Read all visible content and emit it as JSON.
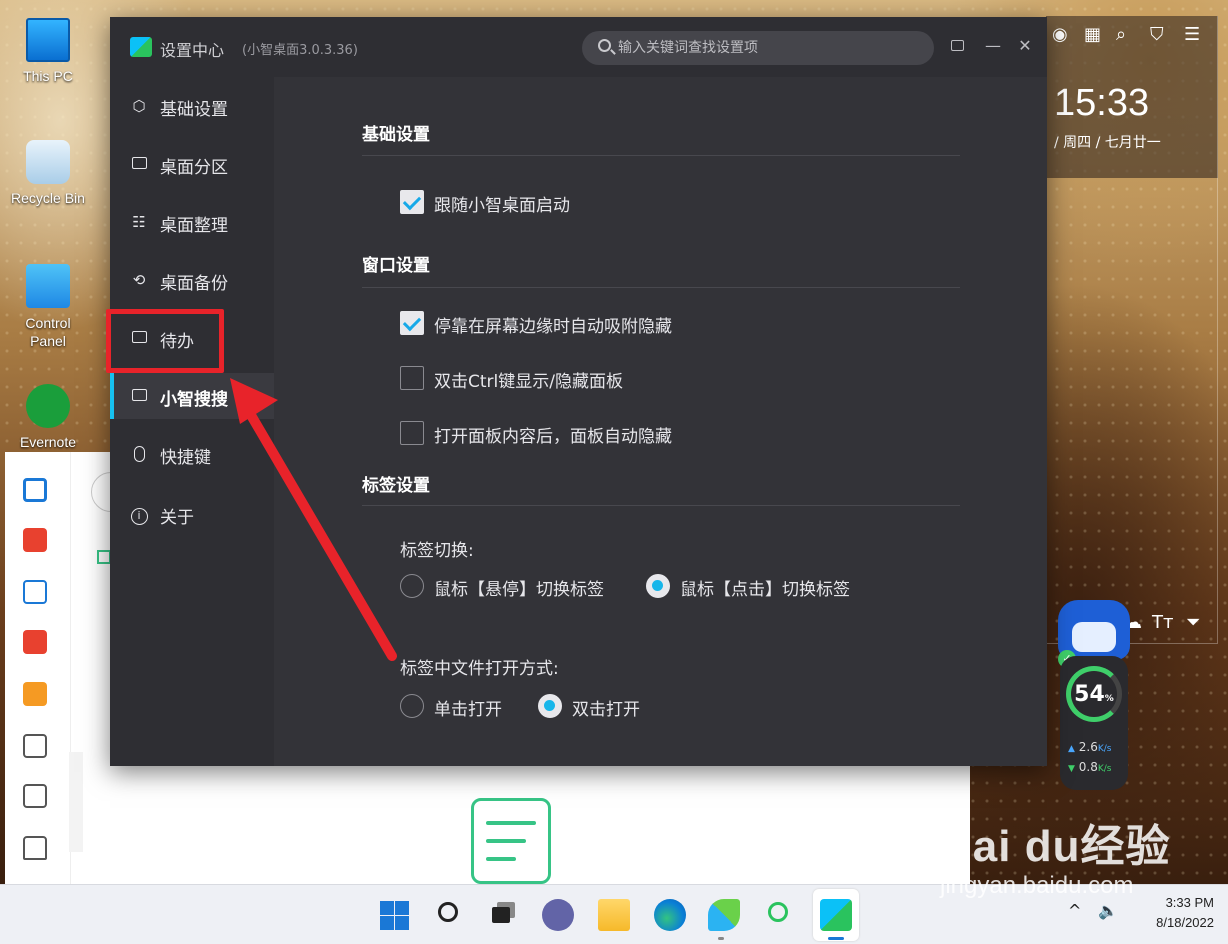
{
  "desktop": {
    "icons": [
      {
        "label": "This PC"
      },
      {
        "label": "Recycle Bin"
      },
      {
        "label": "Control\nPanel"
      },
      {
        "label": "Evernote"
      }
    ]
  },
  "clock_widget": {
    "time": "15:33",
    "date": "/ 周四 / 七月廿一",
    "icons": [
      "user-icon",
      "calendar-icon",
      "search-icon",
      "shirt-icon",
      "menu-icon"
    ]
  },
  "speed_widget": {
    "percent": "54",
    "percent_unit": "%",
    "upload": "2.6",
    "download": "0.8",
    "unit": "K/s"
  },
  "settings_window": {
    "title": "设置中心",
    "version": "(小智桌面3.0.3.36)",
    "search_placeholder": "输入关键词查找设置项",
    "sidebar": {
      "items": [
        {
          "label": "基础设置",
          "icon": "hexagon-icon"
        },
        {
          "label": "桌面分区",
          "icon": "monitor-icon"
        },
        {
          "label": "桌面整理",
          "icon": "grid-list-icon"
        },
        {
          "label": "桌面备份",
          "icon": "sync-icon"
        },
        {
          "label": "待办",
          "icon": "calendar-check-icon"
        },
        {
          "label": "小智搜搜",
          "icon": "window-icon",
          "active": true
        },
        {
          "label": "快捷键",
          "icon": "mouse-icon"
        },
        {
          "label": "关于",
          "icon": "info-icon"
        }
      ]
    },
    "sections": {
      "basic": {
        "title": "基础设置",
        "options": [
          {
            "label": "跟随小智桌面启动",
            "checked": true
          }
        ]
      },
      "window": {
        "title": "窗口设置",
        "options": [
          {
            "label": "停靠在屏幕边缘时自动吸附隐藏",
            "checked": true
          },
          {
            "label": "双击Ctrl键显示/隐藏面板",
            "checked": false
          },
          {
            "label": "打开面板内容后，面板自动隐藏",
            "checked": false
          }
        ]
      },
      "tabs": {
        "title": "标签设置",
        "switch_label": "标签切换:",
        "switch_options": [
          {
            "label": "鼠标【悬停】切换标签",
            "selected": false
          },
          {
            "label": "鼠标【点击】切换标签",
            "selected": true
          }
        ],
        "open_label": "标签中文件打开方式:",
        "open_options": [
          {
            "label": "单击打开",
            "selected": false
          },
          {
            "label": "双击打开",
            "selected": true
          }
        ]
      }
    }
  },
  "taskbar": {
    "time": "3:33 PM",
    "date": "8/18/2022"
  },
  "watermark": {
    "brand": "Bai du经验",
    "url": "jingyan.baidu.com"
  },
  "colors": {
    "accent": "#17c1f0",
    "annotation": "#e8232a",
    "window_bg": "#333338",
    "sidebar_bg": "#2e2e33"
  }
}
